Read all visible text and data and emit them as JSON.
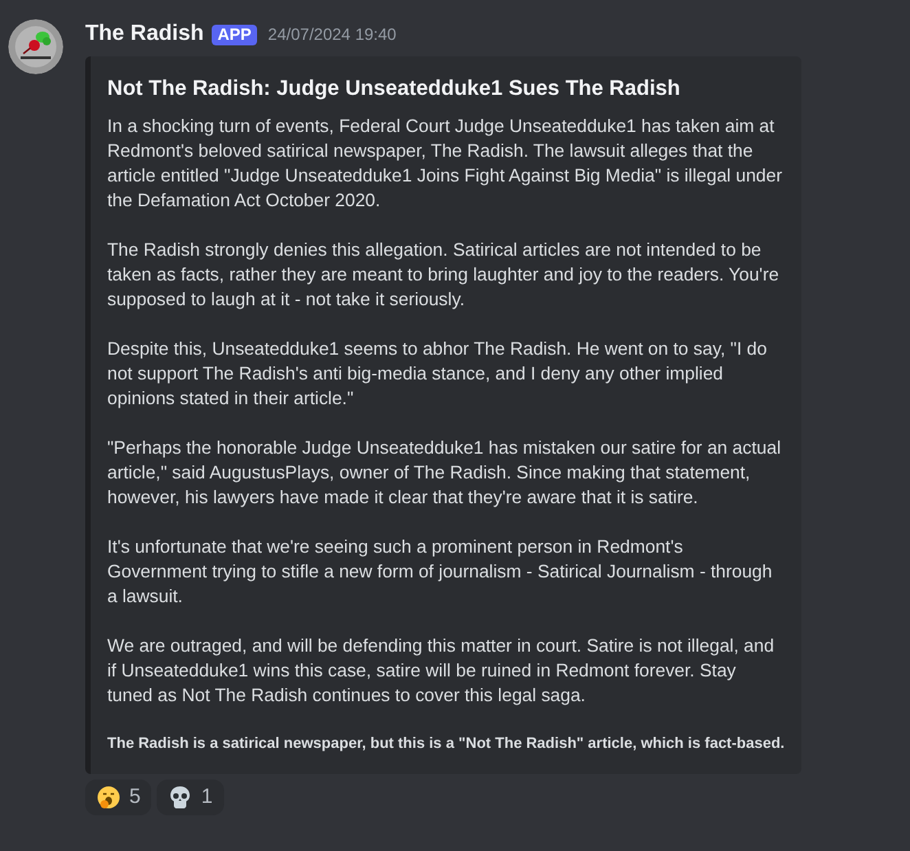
{
  "message": {
    "author": "The Radish",
    "badge": "APP",
    "timestamp": "24/07/2024 19:40"
  },
  "embed": {
    "title": "Not The Radish: Judge Unseatedduke1 Sues The Radish",
    "paragraphs": [
      "In a shocking turn of events, Federal Court Judge Unseatedduke1 has taken aim at Redmont's beloved satirical newspaper, The Radish. The lawsuit alleges that the article entitled \"Judge Unseatedduke1 Joins Fight Against Big Media\" is illegal under the Defamation Act October 2020.",
      "The Radish strongly denies this allegation. Satirical articles are not intended to be taken as facts, rather they are meant to bring laughter and joy to the readers. You're supposed to laugh at it - not take it seriously.",
      "Despite this, Unseatedduke1 seems to abhor The Radish. He went on to say, \"I do not support The Radish's anti big-media stance, and I deny any other implied opinions stated in their article.\"",
      "\"Perhaps the honorable Judge Unseatedduke1 has mistaken our satire for an actual article,\" said AugustusPlays, owner of The Radish. Since making that statement, however, his lawyers have made it clear that they're aware that it is satire.",
      "It's unfortunate that we're seeing such a prominent person in Redmont's Government trying to stifle a new form of journalism - Satirical Journalism - through a lawsuit.",
      "We are outraged, and will be defending this matter in court. Satire is not illegal, and if Unseatedduke1 wins this case, satire will be ruined in Redmont forever. Stay tuned as Not The Radish continues to cover this legal saga."
    ],
    "footer": "The Radish is a satirical newspaper, but this is a \"Not The Radish\" article, which is fact-based."
  },
  "reactions": [
    {
      "kind": "yawn",
      "count": "5"
    },
    {
      "kind": "skull",
      "count": "1"
    }
  ]
}
